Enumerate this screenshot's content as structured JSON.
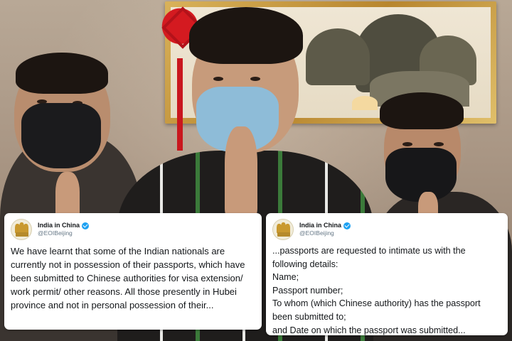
{
  "tweets": [
    {
      "display_name": "India in China",
      "handle": "@EOIBeijing",
      "avatar_icon": "national-emblem-icon",
      "verified_icon": "verified-badge-icon",
      "text": "We have learnt that some of the Indian nationals are currently not in possession of their passports, which have been submitted to Chinese authorities for visa extension/ work permit/ other reasons. All those presently in Hubei province and not in personal possession of their..."
    },
    {
      "display_name": "India in China",
      "handle": "@EOIBeijing",
      "avatar_icon": "national-emblem-icon",
      "verified_icon": "verified-badge-icon",
      "text": "...passports are requested to intimate us with the following details:\nName;\nPassport number;\nTo whom (which Chinese authority) has the passport been submitted to;\nand Date on which the passport was submitted..."
    }
  ],
  "colors": {
    "verified": "#1da1f2",
    "card_background": "#ffffff",
    "text_primary": "#14171a",
    "text_secondary": "#657786"
  }
}
